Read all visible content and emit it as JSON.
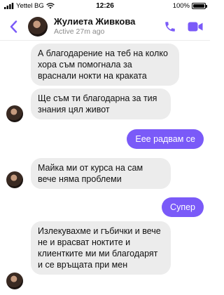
{
  "status_bar": {
    "carrier": "Yettel BG",
    "time": "12:26",
    "battery": "100%",
    "battery_level": 1.0
  },
  "header": {
    "back_icon": "chevron-left-icon",
    "contact_name": "Жулиета Живкова",
    "contact_status": "Active 27m ago",
    "call_icon": "phone-icon",
    "video_icon": "video-camera-icon"
  },
  "colors": {
    "accent": "#7a5af8",
    "incoming_bubble": "#ececec",
    "outgoing_bubble": "#7a5af8"
  },
  "messages": [
    {
      "direction": "incoming",
      "text": "А благодарение на теб на колко хора съм помогнала за враснали нокти на краката"
    },
    {
      "direction": "incoming",
      "text": "Ще съм ти благодарна за тия знания цял живот"
    },
    {
      "direction": "outgoing",
      "text": "Еее радвам се"
    },
    {
      "direction": "incoming",
      "text": "Майка ми от курса на сам вече няма проблеми"
    },
    {
      "direction": "outgoing",
      "text": "Супер"
    },
    {
      "direction": "incoming",
      "text": "Излекувахме и гъбички и вече не и врасват ноктите и клиентките ми ми благодарят и се връщата при мен"
    }
  ]
}
